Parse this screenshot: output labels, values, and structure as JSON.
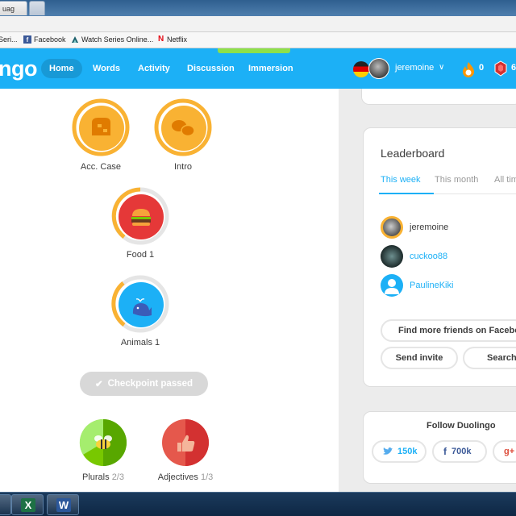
{
  "browser": {
    "tab_title": "uag",
    "bookmarks": [
      {
        "label": "Seri...",
        "icon": "page-icon"
      },
      {
        "label": "Facebook",
        "icon": "facebook-icon"
      },
      {
        "label": "Watch Series Online...",
        "icon": "watchseries-icon"
      },
      {
        "label": "Netflix",
        "icon": "netflix-icon"
      }
    ]
  },
  "nav": {
    "logo": "ngo",
    "items": [
      "Home",
      "Words",
      "Activity",
      "Discussion",
      "Immersion"
    ],
    "active": "Home",
    "username": "jeremoine",
    "caret": "∨",
    "streak": "0",
    "gems": "6",
    "brand_color": "#1cb0f6"
  },
  "skills": [
    {
      "name": "Acc. Case",
      "color": "#f9b233",
      "icon": "acc-case-icon"
    },
    {
      "name": "Intro",
      "color": "#f9b233",
      "icon": "speech-bubbles-icon"
    },
    {
      "name": "Food 1",
      "color": "#e53838",
      "icon": "burger-icon"
    },
    {
      "name": "Animals 1",
      "color": "#1cb0f6",
      "icon": "whale-icon"
    },
    {
      "name": "Plurals",
      "progress": "2/3",
      "color": "#78c800",
      "icon": "bee-icon"
    },
    {
      "name": "Adjectives",
      "progress": "1/3",
      "color": "#e5584c",
      "icon": "thumbs-up-icon"
    }
  ],
  "checkpoint": {
    "label": "Checkpoint passed",
    "icon": "checkmark-icon"
  },
  "leaderboard": {
    "title": "Leaderboard",
    "tabs": [
      "This week",
      "This month",
      "All tim"
    ],
    "active_tab": "This week",
    "users": [
      {
        "name": "jeremoine",
        "is_self": true
      },
      {
        "name": "cuckoo88",
        "is_self": false
      },
      {
        "name": "PaulineKiki",
        "is_self": false
      }
    ],
    "find_friends": "Find more friends on Faceboo",
    "send_invite": "Send invite",
    "search": "Search"
  },
  "follow": {
    "title": "Follow Duolingo",
    "twitter": "150k",
    "facebook": "700k",
    "gplus": "g+"
  },
  "taskbar": {
    "apps": [
      {
        "name": "blank-app",
        "glyph": ""
      },
      {
        "name": "excel",
        "glyph": "X"
      },
      {
        "name": "word",
        "glyph": "W"
      }
    ]
  }
}
